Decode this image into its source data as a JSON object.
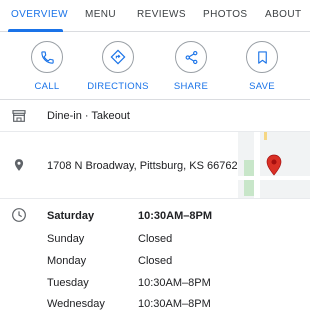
{
  "tabs": [
    {
      "label": "OVERVIEW",
      "active": true
    },
    {
      "label": "MENU",
      "active": false
    },
    {
      "label": "REVIEWS",
      "active": false
    },
    {
      "label": "PHOTOS",
      "active": false
    },
    {
      "label": "ABOUT",
      "active": false
    }
  ],
  "actions": [
    {
      "label": "CALL",
      "icon": "phone-icon"
    },
    {
      "label": "DIRECTIONS",
      "icon": "directions-icon"
    },
    {
      "label": "SHARE",
      "icon": "share-icon"
    },
    {
      "label": "SAVE",
      "icon": "bookmark-icon"
    }
  ],
  "service_options": {
    "text": "Dine-in · Takeout",
    "icon": "storefront-icon"
  },
  "address": {
    "text": "1708 N Broadway, Pittsburg, KS 66762",
    "icon": "location-pin-icon"
  },
  "hours": {
    "icon": "clock-icon",
    "rows": [
      {
        "day": "Saturday",
        "time": "10:30AM–8PM",
        "current": true
      },
      {
        "day": "Sunday",
        "time": "Closed",
        "current": false
      },
      {
        "day": "Monday",
        "time": "Closed",
        "current": false
      },
      {
        "day": "Tuesday",
        "time": "10:30AM–8PM",
        "current": false
      },
      {
        "day": "Wednesday",
        "time": "10:30AM–8PM",
        "current": false
      }
    ]
  },
  "colors": {
    "accent": "#1a73e8",
    "icon_gray": "#5f6368",
    "map_pin": "#d93025"
  }
}
